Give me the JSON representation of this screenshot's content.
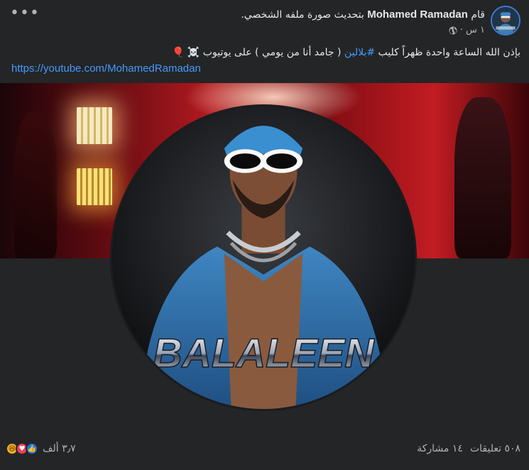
{
  "header": {
    "prefix": "قام",
    "name": "Mohamed Ramadan",
    "action": "بتحديث صورة ملفه الشخصي.",
    "time": "١ س ·",
    "more_label": "•••",
    "avatar_icon": "profile-avatar"
  },
  "post": {
    "text_before": "بإذن الله الساعة واحدة ظهراً كليب ",
    "hashtag": "#بلالين",
    "text_after": " ( جامد أنا من يومي ) على يوتيوب ☠️ 🎈",
    "link": "https://youtube.com/MohamedRamadan"
  },
  "image": {
    "banner_text": "BALALEEN"
  },
  "footer": {
    "reactions_count": "٣٫٧ ألف",
    "comments": "٥٠٨ تعليقات",
    "shares": "١٤ مشاركة",
    "reaction_icons": [
      "like-icon",
      "love-icon",
      "haha-icon"
    ]
  },
  "colors": {
    "background": "#242526",
    "text": "#e4e6eb",
    "secondary": "#b0b3b8",
    "link": "#4599ff"
  }
}
